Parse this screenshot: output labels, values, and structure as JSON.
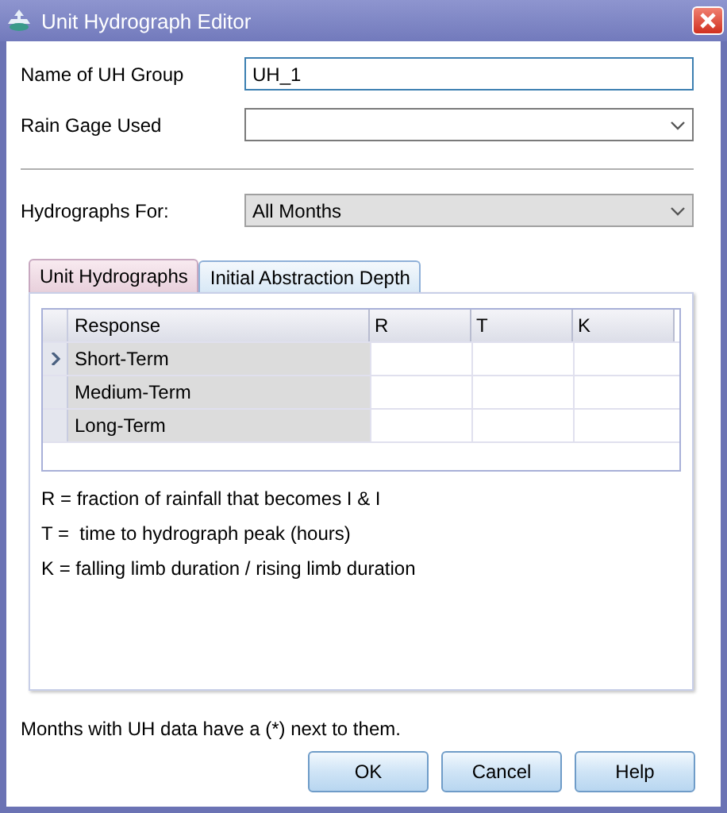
{
  "window": {
    "title": "Unit Hydrograph Editor"
  },
  "fields": [
    {
      "label": "Name of UH Group",
      "kind": "text",
      "value": "UH_1",
      "focused": true
    },
    {
      "label": "Rain Gage Used",
      "kind": "dropdown",
      "focused": false
    }
  ],
  "hydrographs_for": {
    "label": "Hydrographs For:",
    "value": "All Months"
  },
  "tabs": [
    {
      "label": "Unit Hydrographs",
      "selected": true
    },
    {
      "label": "Initial Abstraction Depth",
      "selected": false
    }
  ],
  "grid": {
    "columns": [
      "Response",
      "R",
      "T",
      "K"
    ],
    "rows": [
      {
        "response": "Short-Term",
        "selected": true
      },
      {
        "response": "Medium-Term",
        "selected": false
      },
      {
        "response": "Long-Term",
        "selected": false
      }
    ]
  },
  "legend": [
    "R = fraction of rainfall that becomes I & I",
    "T =  time to hydrograph peak (hours)",
    "K = falling limb duration / rising limb duration"
  ],
  "note": "Months with UH data have a (*)  next to them.",
  "buttons": [
    "OK",
    "Cancel",
    "Help"
  ]
}
